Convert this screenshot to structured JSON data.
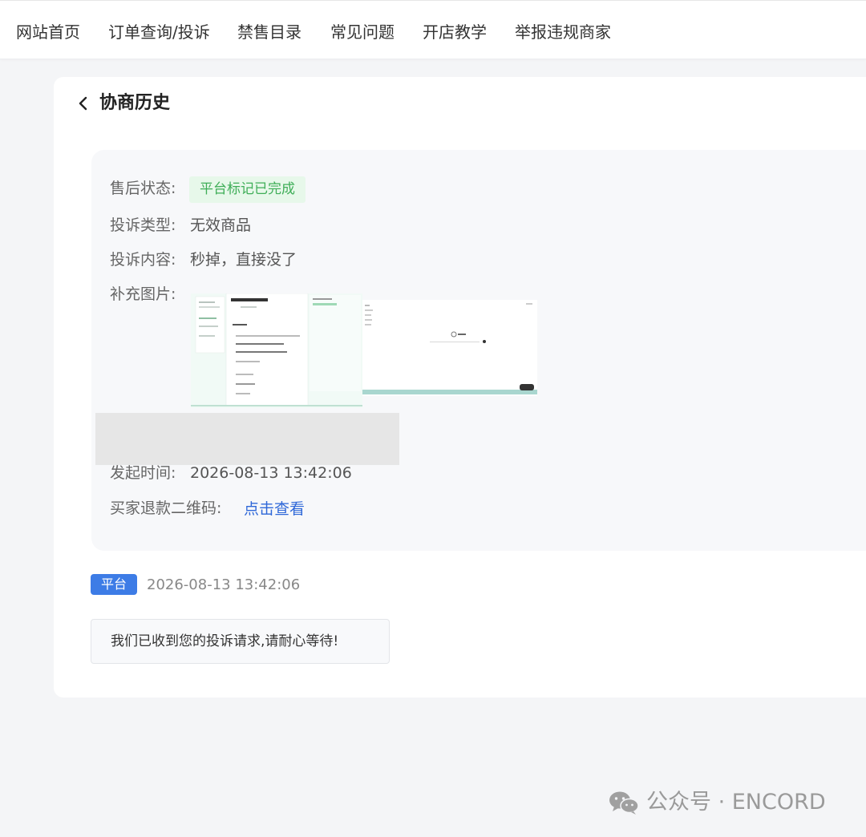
{
  "nav": {
    "items": [
      "网站首页",
      "订单查询/投诉",
      "禁售目录",
      "常见问题",
      "开店教学",
      "举报违规商家"
    ]
  },
  "page": {
    "title": "协商历史",
    "back_icon": "chevron-left-icon"
  },
  "details": {
    "status_label": "售后状态:",
    "status_value": "平台标记已完成",
    "type_label": "投诉类型:",
    "type_value": "无效商品",
    "content_label": "投诉内容:",
    "content_value": "秒掉，直接没了",
    "images_label": "补充图片:",
    "time_label": "发起时间:",
    "time_value": "2026-08-13 13:42:06",
    "qr_label": "买家退款二维码:",
    "qr_link": "点击查看"
  },
  "message": {
    "sender": "平台",
    "time": "2026-08-13 13:42:06",
    "text": "我们已收到您的投诉请求,请耐心等待!"
  },
  "watermark": {
    "icon": "wechat-icon",
    "text": "公众号 · ENCORD"
  },
  "colors": {
    "accent": "#3d7ce6",
    "link": "#2f68d8",
    "status_bg": "#e7f8ea",
    "status_text": "#3fae58",
    "page_bg": "#f4f5f7"
  }
}
